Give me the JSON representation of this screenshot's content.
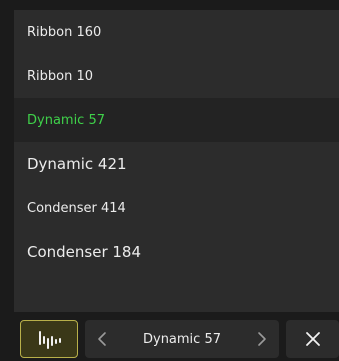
{
  "list": {
    "items": [
      {
        "label": "Ribbon 160"
      },
      {
        "label": "Ribbon 10"
      },
      {
        "label": "Dynamic 57"
      },
      {
        "label": "Dynamic 421"
      },
      {
        "label": "Condenser 414"
      },
      {
        "label": "Condenser 184"
      }
    ],
    "selected_index": 2
  },
  "toolbar": {
    "wave_icon": "waveform-icon",
    "selector_label": "Dynamic 57",
    "prev_icon": "chevron-left-icon",
    "next_icon": "chevron-right-icon",
    "close_icon": "close-icon"
  },
  "colors": {
    "selected_text": "#3fd14a",
    "accent_border": "#b8b04a"
  }
}
